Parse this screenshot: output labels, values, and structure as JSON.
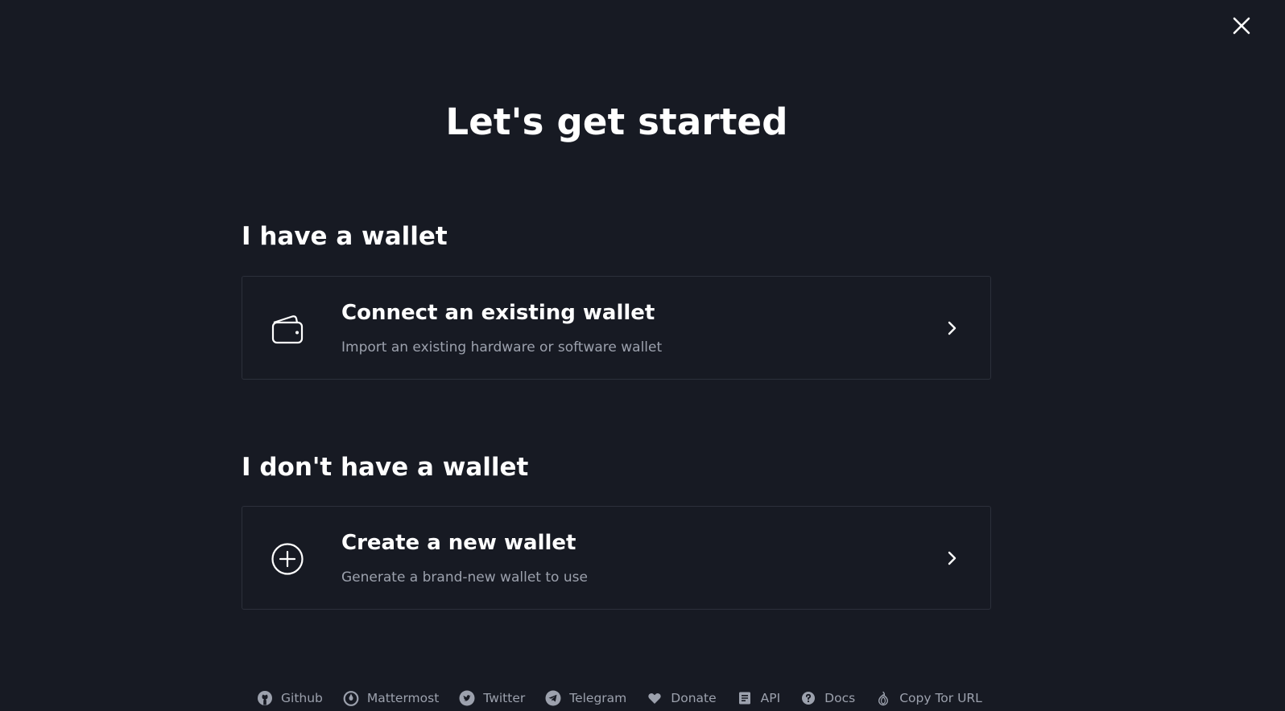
{
  "page": {
    "title": "Let's get started",
    "close_icon": "close-icon"
  },
  "sections": [
    {
      "heading": "I have a wallet",
      "card": {
        "icon": "wallet-icon",
        "title": "Connect an existing wallet",
        "subtitle": "Import an existing hardware or software wallet"
      }
    },
    {
      "heading": "I don't have a wallet",
      "card": {
        "icon": "plus-circle-icon",
        "title": "Create a new wallet",
        "subtitle": "Generate a brand-new wallet to use"
      }
    }
  ],
  "footer": {
    "links": [
      {
        "label": "Github",
        "icon": "github-icon"
      },
      {
        "label": "Mattermost",
        "icon": "mattermost-icon"
      },
      {
        "label": "Twitter",
        "icon": "twitter-icon"
      },
      {
        "label": "Telegram",
        "icon": "telegram-icon"
      },
      {
        "label": "Donate",
        "icon": "heart-icon"
      },
      {
        "label": "API",
        "icon": "document-icon"
      },
      {
        "label": "Docs",
        "icon": "help-icon"
      },
      {
        "label": "Copy Tor URL",
        "icon": "tor-onion-icon"
      }
    ]
  },
  "colors": {
    "background": "#171a23",
    "card_border": "#2c303b",
    "text_primary": "#ffffff",
    "text_muted": "#9ca1ad"
  }
}
